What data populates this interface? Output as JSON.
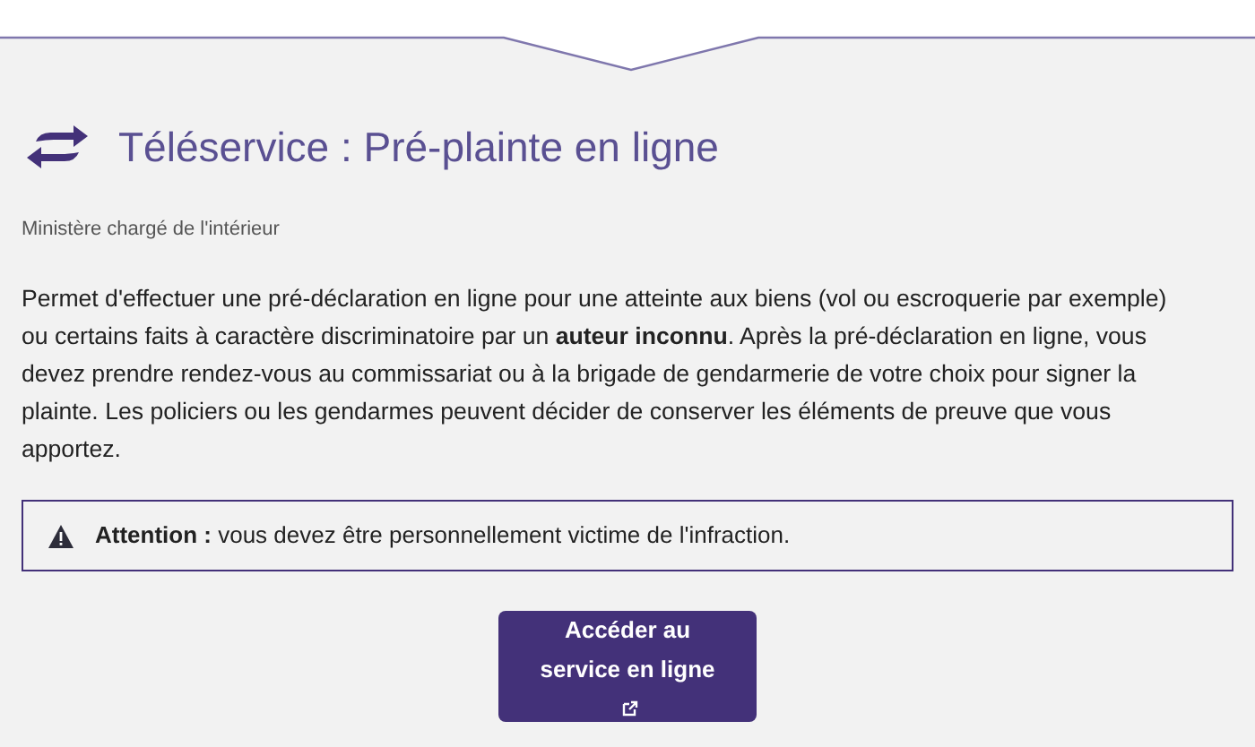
{
  "service": {
    "title": "Téléservice : Pré-plainte en ligne",
    "ministry": "Ministère chargé de l'intérieur",
    "description": "Permet d'effectuer une pré-déclaration en ligne pour une atteinte aux biens (vol ou escroquerie par exemple) ou certains faits à caractère discriminatoire par un **auteur inconnu**. Après la pré-déclaration en ligne, vous devez prendre rendez-vous au commissariat ou à la brigade de gendarmerie de votre choix pour signer la plainte. Les policiers ou les gendarmes peuvent décider de conserver les éléments de preuve que vous apportez.",
    "warning": "**Attention :** vous devez être personnellement victime de l'infraction.",
    "button": "Accéder au service en ligne"
  }
}
